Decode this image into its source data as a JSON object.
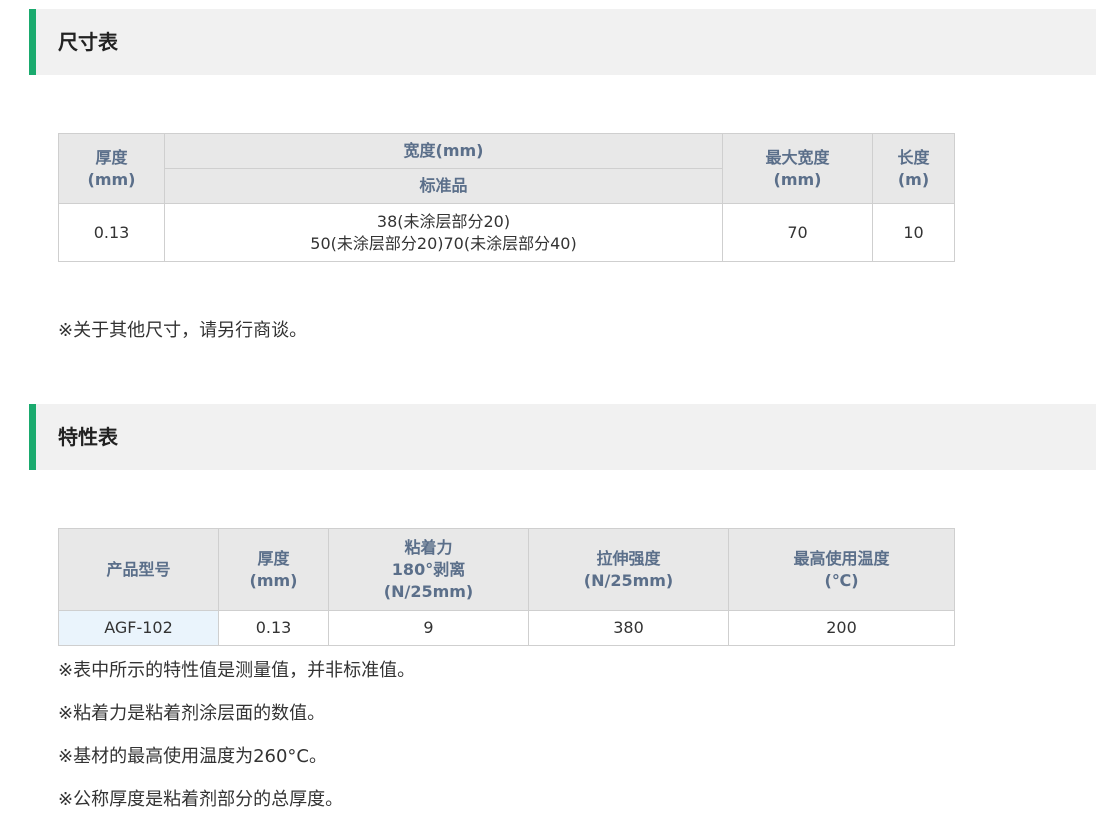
{
  "size_section": {
    "title": "尺寸表",
    "table": {
      "headers": {
        "thickness": [
          "厚度",
          "(mm)"
        ],
        "width": "宽度(mm)",
        "standard": "标准品",
        "max_width": [
          "最大宽度",
          "(mm)"
        ],
        "length": [
          "长度",
          "(m)"
        ]
      },
      "row": {
        "thickness": "0.13",
        "standard_lines": [
          "38(未涂层部分20)",
          "50(未涂层部分20)70(未涂层部分40)"
        ],
        "max_width": "70",
        "length": "10"
      }
    },
    "note": "※关于其他尺寸，请另行商谈。"
  },
  "property_section": {
    "title": "特性表",
    "table": {
      "headers": {
        "model": "产品型号",
        "thickness": [
          "厚度",
          "(mm)"
        ],
        "adhesion": [
          "粘着力",
          "180°剥离",
          "(N/25mm)"
        ],
        "tensile": [
          "拉伸强度",
          "(N/25mm)"
        ],
        "max_temp": [
          "最高使用温度",
          "(℃)"
        ]
      },
      "row": {
        "model": "AGF-102",
        "thickness": "0.13",
        "adhesion": "9",
        "tensile": "380",
        "max_temp": "200"
      }
    },
    "notes": [
      "※表中所示的特性值是测量值，并非标准值。",
      "※粘着力是粘着剂涂层面的数值。",
      "※基材的最高使用温度为260°C。",
      "※公称厚度是粘着剂部分的总厚度。"
    ]
  },
  "colors": {
    "accent": "#1aaa6e",
    "header_bg": "#e8e8e8",
    "header_text": "#5b6f8a",
    "section_bg": "#f1f1f1",
    "model_cell_bg": "#eaf4fc"
  }
}
